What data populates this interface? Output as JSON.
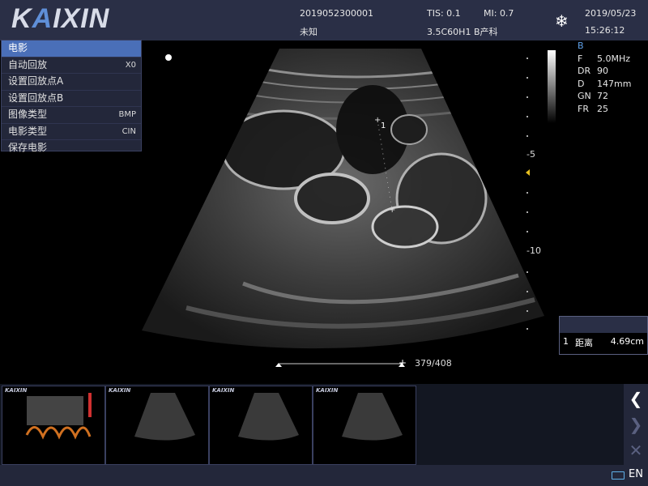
{
  "header": {
    "logo_main": "K",
    "logo_a": "A",
    "logo_rest": "IXIN",
    "patient_id": "2019052300001",
    "patient_name": "未知",
    "tis": "TIS: 0.1",
    "mi": "MI: 0.7",
    "probe": "3.5C60H1 B产科",
    "date": "2019/05/23",
    "time": "15:26:12",
    "freeze_icon": "snowflake-icon"
  },
  "menu": {
    "items": [
      {
        "label": "电影",
        "key": ""
      },
      {
        "label": "自动回放",
        "key": "X0"
      },
      {
        "label": "设置回放点A",
        "key": ""
      },
      {
        "label": "设置回放点B",
        "key": ""
      },
      {
        "label": "图像类型",
        "key": "BMP"
      },
      {
        "label": "电影类型",
        "key": "CIN"
      },
      {
        "label": "保存电影",
        "key": ""
      }
    ]
  },
  "params": {
    "mode": "B",
    "rows": [
      {
        "k": "F",
        "v": "5.0MHz"
      },
      {
        "k": "DR",
        "v": "90"
      },
      {
        "k": "D",
        "v": "147mm"
      },
      {
        "k": "GN",
        "v": "72"
      },
      {
        "k": "FR",
        "v": "25"
      }
    ]
  },
  "depth": {
    "labels": [
      "-5",
      "-10"
    ]
  },
  "measurement": {
    "index": "1",
    "name": "距离",
    "value": "4.69cm",
    "caliper_label": "1"
  },
  "cine": {
    "frame": "379/408"
  },
  "thumbnails": {
    "logo": "KAIXIN",
    "count": 4
  },
  "nav": {
    "prev_icon": "chevron-left-icon",
    "next_icon": "chevron-right-icon",
    "close_icon": "close-icon"
  },
  "status": {
    "language": "EN"
  },
  "colors": {
    "header_bg": "#2a2f46",
    "menu_active": "#4a6fb8",
    "focus_marker": "#e8c020",
    "mode_label": "#5fa0e8"
  }
}
